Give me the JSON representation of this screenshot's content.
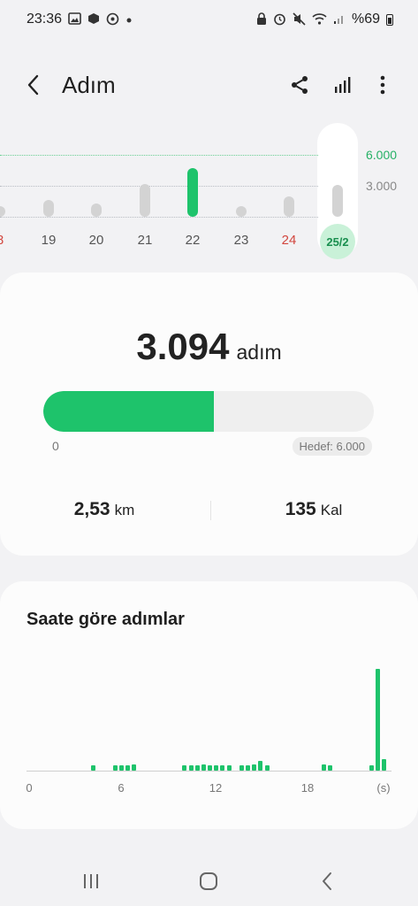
{
  "status_bar": {
    "time": "23:36",
    "left_icons": [
      "gallery-icon",
      "box-icon",
      "whatsapp-icon",
      "dot-icon"
    ],
    "right_icons": [
      "lock-icon",
      "alarm-icon",
      "mute-icon",
      "wifi-icon",
      "signal-icon"
    ],
    "battery_text": "%69"
  },
  "appbar": {
    "title": "Adım",
    "back_icon": "back-arrow-icon",
    "actions": [
      "share-icon",
      "bar-chart-icon",
      "more-vert-icon"
    ]
  },
  "day_chart": {
    "y_labels": [
      "6.000",
      "3.000"
    ],
    "selected_day": "25/2",
    "days": [
      {
        "label": "8",
        "weekend": true,
        "steps": 600
      },
      {
        "label": "19",
        "weekend": false,
        "steps": 1650
      },
      {
        "label": "20",
        "weekend": false,
        "steps": 1300
      },
      {
        "label": "21",
        "weekend": false,
        "steps": 3200
      },
      {
        "label": "22",
        "weekend": false,
        "steps": 4700,
        "goal_met": true
      },
      {
        "label": "23",
        "weekend": false,
        "steps": 600
      },
      {
        "label": "24",
        "weekend": true,
        "steps": 2000
      },
      {
        "label": "25/2",
        "weekend": false,
        "steps": 3094,
        "selected": true
      }
    ],
    "colors": {
      "active": "#1ec36b",
      "inactive": "#d3d3d3",
      "weekend_label": "#d2463e"
    }
  },
  "summary": {
    "steps": "3.094",
    "steps_unit": "adım",
    "progress_fraction": 0.5157,
    "progress_start": "0",
    "goal_label": "Hedef: 6.000",
    "distance_value": "2,53",
    "distance_unit": "km",
    "calories_value": "135",
    "calories_unit": "Kal"
  },
  "hourly": {
    "title": "Saate göre adımlar",
    "x_labels": [
      "0",
      "6",
      "12",
      "18",
      "(s)"
    ],
    "values": [
      [
        4,
        5
      ],
      [
        5.4,
        5
      ],
      [
        5.8,
        5
      ],
      [
        6.2,
        5
      ],
      [
        6.6,
        6
      ],
      [
        9.8,
        5
      ],
      [
        10.2,
        5
      ],
      [
        10.6,
        5
      ],
      [
        11,
        6
      ],
      [
        11.4,
        5
      ],
      [
        11.8,
        5
      ],
      [
        12.2,
        5
      ],
      [
        12.6,
        5
      ],
      [
        13.4,
        5
      ],
      [
        13.8,
        5
      ],
      [
        14.2,
        6
      ],
      [
        14.6,
        10
      ],
      [
        15,
        5
      ],
      [
        18.6,
        6
      ],
      [
        19,
        5
      ],
      [
        21.6,
        5
      ],
      [
        22,
        100
      ],
      [
        22.4,
        11
      ]
    ]
  }
}
